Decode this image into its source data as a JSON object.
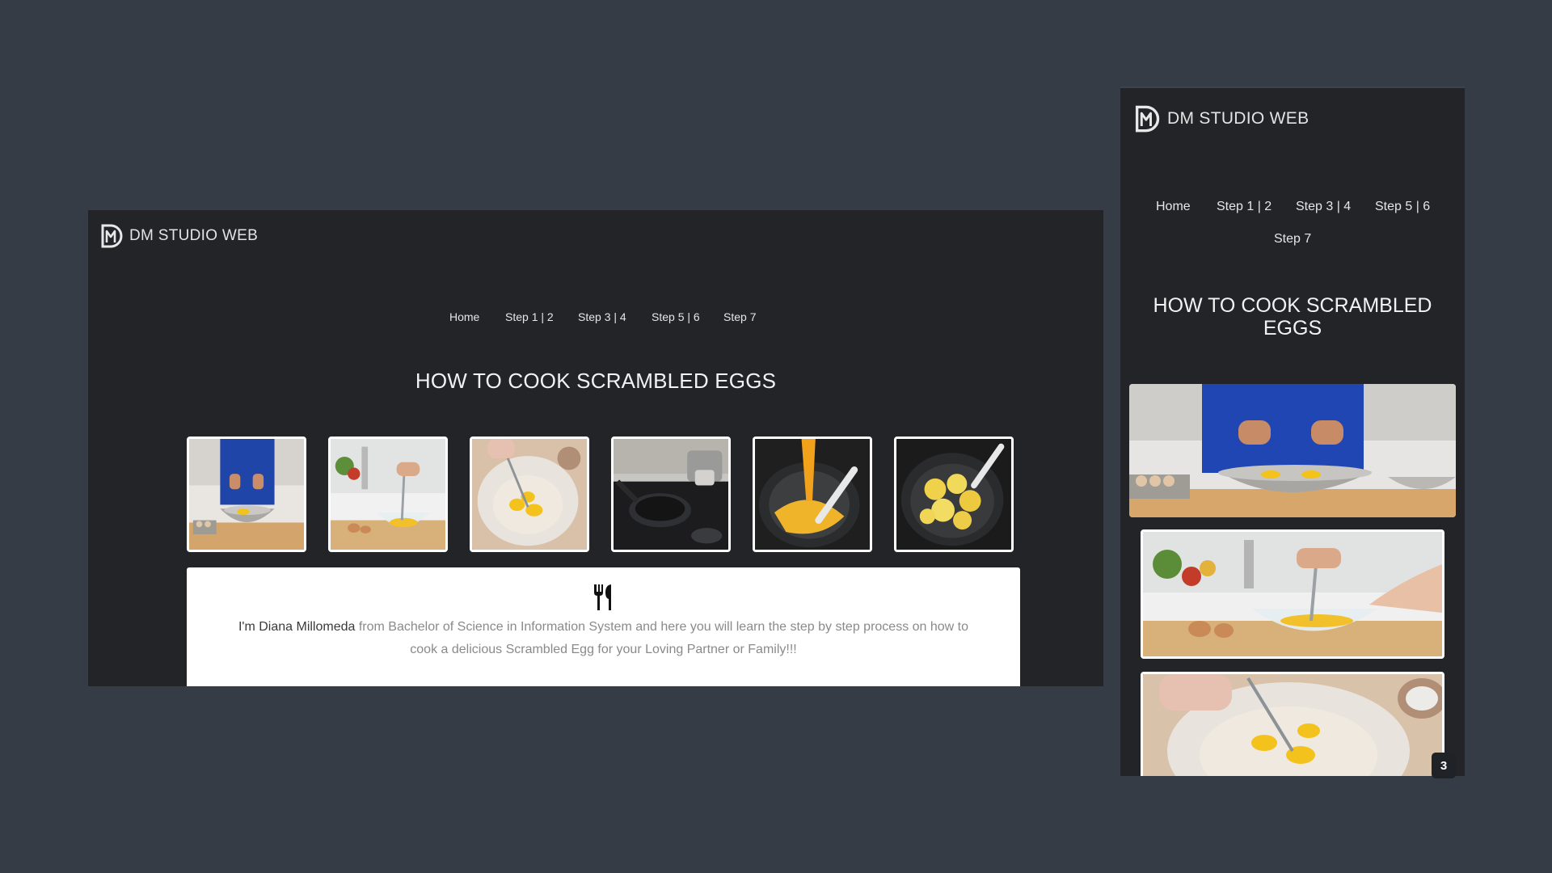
{
  "brand": {
    "name": "DM STUDIO WEB",
    "logo_icon": "dm-monogram-icon"
  },
  "nav": {
    "items": [
      "Home",
      "Step 1 | 2",
      "Step 3 | 4",
      "Step 5 | 6",
      "Step 7"
    ]
  },
  "page": {
    "title": "HOW TO COOK SCRAMBLED EGGS"
  },
  "gallery": {
    "items": [
      {
        "alt": "Cracking eggs into a bowl"
      },
      {
        "alt": "Whisking eggs in a glass bowl"
      },
      {
        "alt": "Beaten egg yolks with whisk"
      },
      {
        "alt": "Frying pan on a stove"
      },
      {
        "alt": "Pouring eggs into pan"
      },
      {
        "alt": "Scrambled eggs in pan"
      }
    ]
  },
  "intro": {
    "icon": "utensils-icon",
    "name": "I'm Diana Millomeda",
    "text": " from Bachelor of Science in Information System and here you will learn the step by step process on how to cook a delicious Scrambled Egg for your Loving Partner or Family!!!"
  },
  "badge": {
    "value": "3"
  },
  "colors": {
    "background": "#363c45",
    "panel": "#222428",
    "card": "#ffffff"
  }
}
